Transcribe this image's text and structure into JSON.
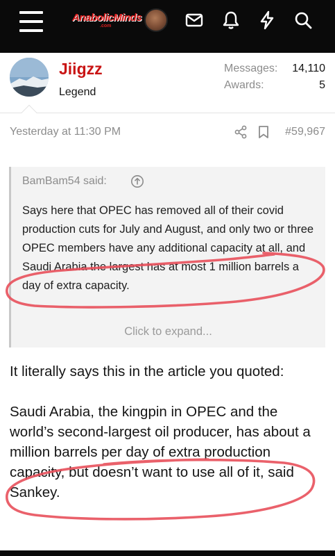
{
  "nav": {
    "logo_text": "AnabolicMinds",
    "logo_sub": ".com",
    "icons": [
      "menu-icon",
      "avatar",
      "mail-icon",
      "bell-icon",
      "lightning-icon",
      "search-icon"
    ]
  },
  "post": {
    "username": "Jiigzz",
    "user_title": "Legend",
    "stats": [
      {
        "label": "Messages:",
        "value": "14,110"
      },
      {
        "label": "Awards:",
        "value": "5"
      }
    ],
    "timestamp": "Yesterday at 11:30 PM",
    "post_number": "#59,967",
    "quote": {
      "author_said": "BamBam54 said:",
      "text": "Says here that OPEC has removed all of their covid production cuts for July and August, and only two or three OPEC members have any additional capacity at all, and Saudi Arabia the largest has at most 1 million barrels a day of extra capacity.",
      "expand_label": "Click to expand..."
    },
    "body": [
      "It literally says this in the article you quoted:",
      "Saudi Arabia, the kingpin in OPEC and the world’s second-largest oil producer, has about a million barrels per day of extra production capacity, but doesn’t want to use all of it, said Sankey."
    ]
  },
  "colors": {
    "username": "#c91414",
    "topbar": "#0a0a0a",
    "annotation": "#e8505b"
  }
}
